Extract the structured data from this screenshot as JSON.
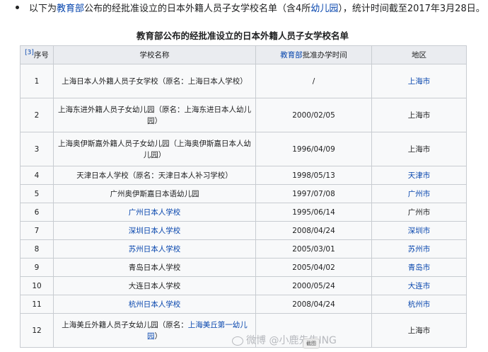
{
  "intro": {
    "text_before": "以下为",
    "link1": "教育部",
    "text_mid": "公布的经批准设立的日本外籍人员子女学校名单（含4所",
    "link2": "幼儿园",
    "text_after": "），统计时间截至2017年3月28日。"
  },
  "caption": "教育部公布的经批准设立的日本外籍人员子女学校名单",
  "table": {
    "headers": {
      "ref": "[3]",
      "index": "序号",
      "name": "学校名称",
      "date_link": "教育部",
      "date_rest": "批准办学时间",
      "region": "地区"
    },
    "rows": [
      {
        "index": "1",
        "name": "上海日本人外籍人员子女学校（原名：上海日本人学校）",
        "date": "/",
        "region": "上海市"
      },
      {
        "index": "2",
        "name": "上海东进外籍人员子女幼儿园（原名：上海东进日本人幼儿园）",
        "date": "2000/02/05",
        "region": "上海市"
      },
      {
        "index": "3",
        "name": "上海奥伊斯嘉外籍人员子女幼儿园（上海奥伊斯嘉日本人幼儿园）",
        "date": "1996/04/09",
        "region": "上海市"
      },
      {
        "index": "4",
        "name": "天津日本人学校（原名：天津日本人补习学校）",
        "date": "1998/05/13",
        "region": "天津市"
      },
      {
        "index": "5",
        "name": "广州奥伊斯嘉日本语幼儿园",
        "date": "1997/07/08",
        "region": "广州市"
      },
      {
        "index": "6",
        "name": "广州日本人学校",
        "date": "1995/06/14",
        "region": "广州市"
      },
      {
        "index": "7",
        "name": "深圳日本人学校",
        "date": "2008/04/24",
        "region": "深圳市"
      },
      {
        "index": "8",
        "name": "苏州日本人学校",
        "date": "2005/03/01",
        "region": "苏州市"
      },
      {
        "index": "9",
        "name": "青岛日本人学校",
        "date": "2005/04/02",
        "region": "青岛市"
      },
      {
        "index": "10",
        "name": "大连日本人学校",
        "date": "2000/05/24",
        "region": "大连市"
      },
      {
        "index": "11",
        "name": "杭州日本人学校",
        "date": "2008/04/24",
        "region": "杭州市"
      },
      {
        "index": "12",
        "name_before": "上海美丘外籍人员子女幼儿园（原名：",
        "name_link": "上海美丘第一幼儿园",
        "name_after": "）",
        "date": "",
        "region": "上海市"
      }
    ]
  },
  "watermark": "微博 @小鹿先生ING",
  "tooltip": "截图",
  "colors": {
    "link": "#0645ad",
    "header_bg": "#eaecf0",
    "cell_bg": "#f8f9fa",
    "border": "#c8ccd1"
  }
}
